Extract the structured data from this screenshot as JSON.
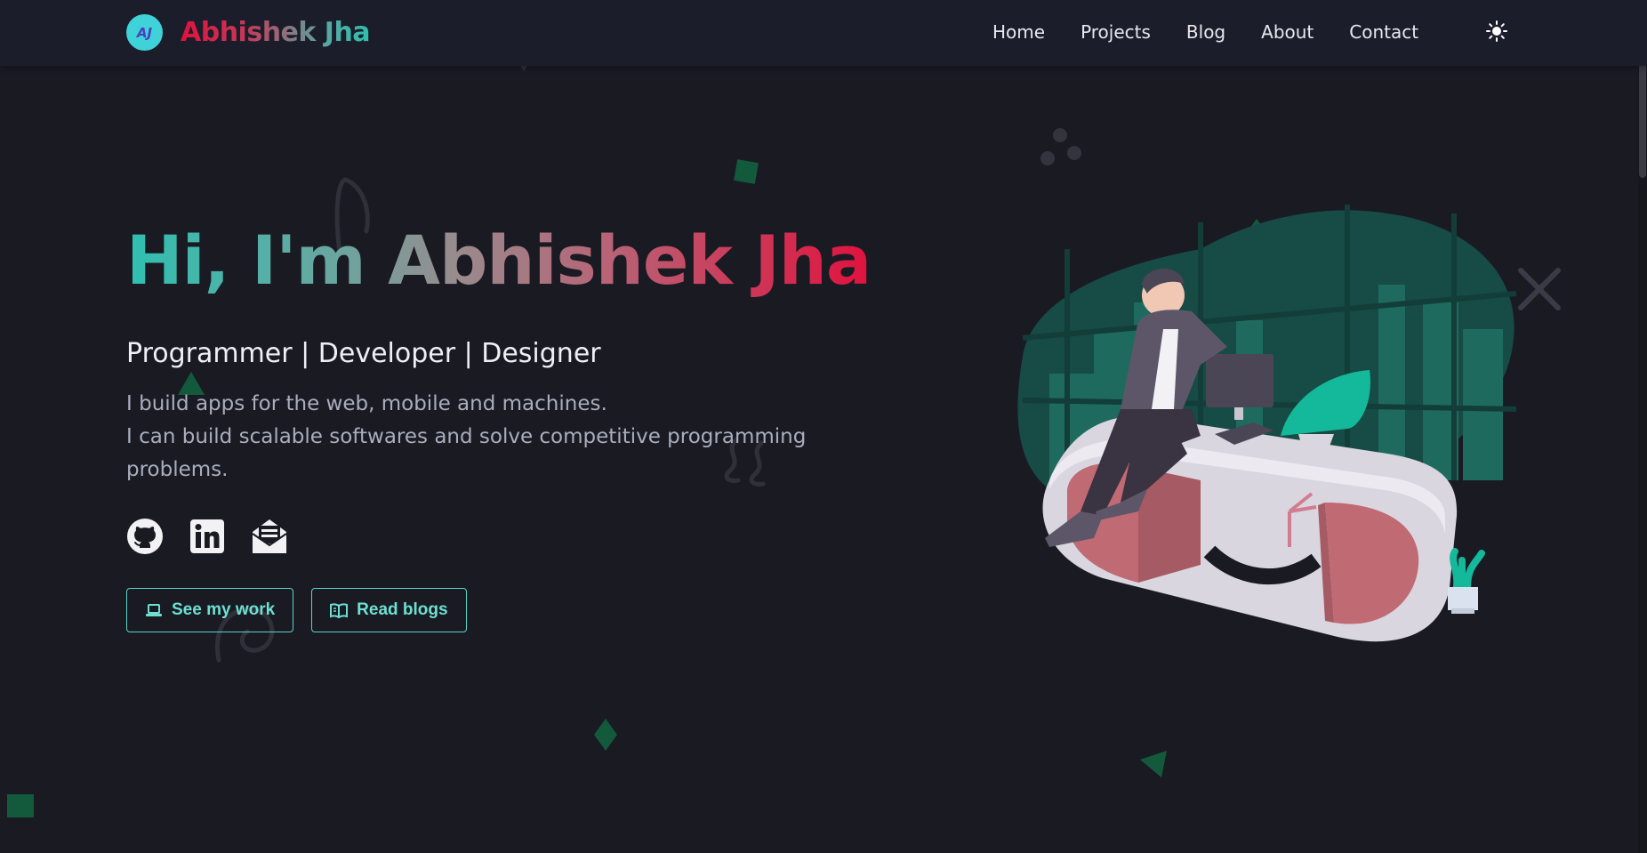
{
  "brand": {
    "logo_text": "AJ",
    "name": "Abhishek Jha"
  },
  "nav": {
    "items": [
      {
        "label": "Home"
      },
      {
        "label": "Projects"
      },
      {
        "label": "Blog"
      },
      {
        "label": "About"
      },
      {
        "label": "Contact"
      }
    ],
    "theme_toggle_icon": "sun-icon"
  },
  "hero": {
    "title": "Hi, I'm Abhishek Jha",
    "subtitle": "Programmer | Developer | Designer",
    "description": [
      "I build apps for the web, mobile and machines.",
      "I can build scalable softwares and solve competitive programming problems."
    ]
  },
  "socials": [
    {
      "icon": "github-icon"
    },
    {
      "icon": "linkedin-icon"
    },
    {
      "icon": "newsletter-icon"
    }
  ],
  "buttons": {
    "work": {
      "label": "See my work",
      "icon": "laptop-icon"
    },
    "blogs": {
      "label": "Read blogs",
      "icon": "book-icon"
    }
  },
  "colors": {
    "background": "#1a1a23",
    "navbar": "#1b1e2a",
    "accent_teal": "#5ad4c6",
    "accent_red": "#e0123e"
  }
}
